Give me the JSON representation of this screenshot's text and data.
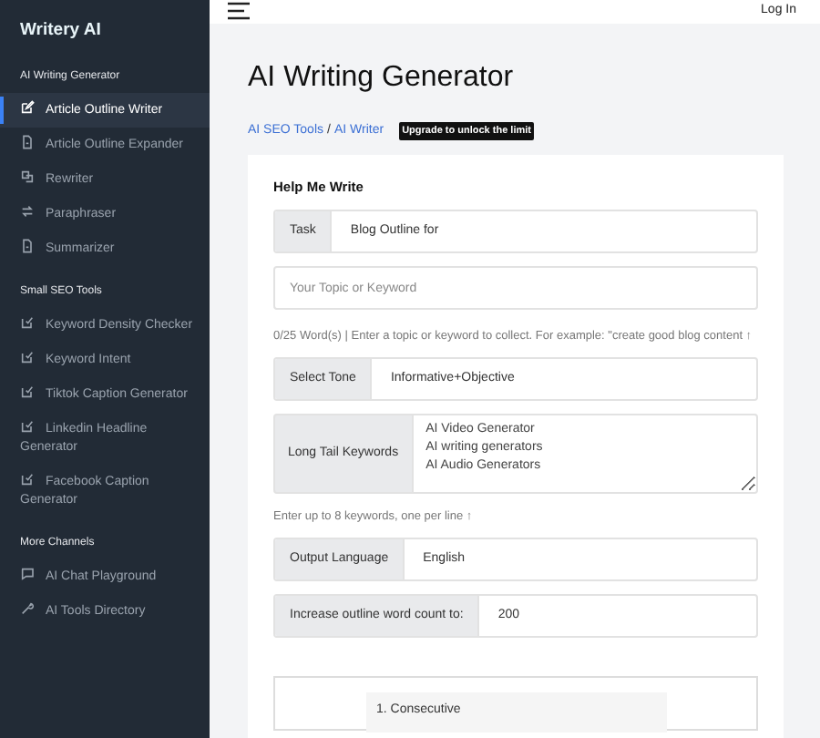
{
  "sidebar": {
    "logo": "Writery AI",
    "sections": [
      {
        "title": "AI Writing Generator",
        "items": [
          {
            "label": "Article Outline Writer",
            "selected": true
          },
          {
            "label": "Article Outline Expander",
            "selected": false
          },
          {
            "label": "Rewriter",
            "selected": false
          },
          {
            "label": "Paraphraser",
            "selected": false
          },
          {
            "label": "Summarizer",
            "selected": false
          }
        ]
      },
      {
        "title": "Small SEO Tools",
        "items": [
          {
            "label": "Keyword Density Checker",
            "selected": false
          },
          {
            "label": "Keyword Intent",
            "selected": false
          },
          {
            "label": "Tiktok Caption Generator",
            "selected": false
          },
          {
            "label": "Linkedin Headline Generator",
            "selected": false
          },
          {
            "label": "Facebook Caption Generator",
            "selected": false
          }
        ]
      },
      {
        "title": "More Channels",
        "items": [
          {
            "label": "AI Chat Playground",
            "selected": false
          },
          {
            "label": "AI Tools Directory",
            "selected": false
          }
        ]
      }
    ]
  },
  "header": {
    "login": "Log In"
  },
  "page": {
    "title": "AI Writing Generator",
    "breadcrumb": [
      "AI SEO Tools",
      "AI Writer"
    ],
    "separator": "/",
    "badge": "Upgrade to unlock the limit"
  },
  "form": {
    "title": "Help Me Write",
    "rows": [
      {
        "kind": "addon",
        "label": "Task",
        "value": "Blog Outline for"
      },
      {
        "kind": "input",
        "placeholder": "Your Topic or Keyword"
      },
      {
        "kind": "hint",
        "text": "0/25 Word(s) | Enter a topic or keyword to collect. For example: \"create good blog content ↑"
      },
      {
        "kind": "addon",
        "label": "Select Tone",
        "value": "Informative+Objective"
      },
      {
        "kind": "textarea",
        "label": "Long Tail Keywords",
        "value": "AI Video Generator\nAI writing generators\nAI Audio Generators"
      },
      {
        "kind": "hint",
        "text": "Enter up to 8 keywords, one per line ↑"
      },
      {
        "kind": "addon",
        "label": "Output Language",
        "value": "English"
      },
      {
        "kind": "addon",
        "label": "Increase outline word count to:",
        "value": "200"
      }
    ],
    "outline": [
      "1. Consecutive"
    ]
  }
}
